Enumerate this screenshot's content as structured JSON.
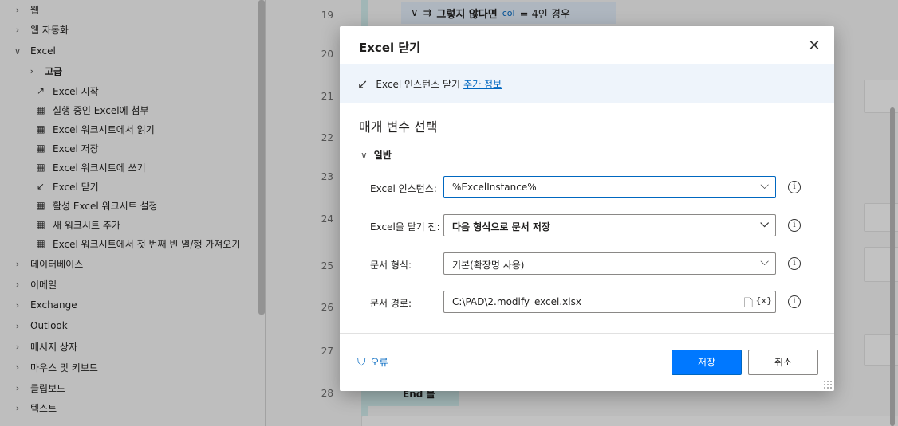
{
  "actions_pane": {
    "items": [
      {
        "type": "group",
        "label": "웹",
        "expanded": false
      },
      {
        "type": "group",
        "label": "웹 자동화",
        "expanded": false
      },
      {
        "type": "group",
        "label": "Excel",
        "expanded": true
      },
      {
        "type": "subgroup",
        "label": "고급",
        "expanded": false
      },
      {
        "type": "action",
        "label": "Excel 시작",
        "icon": "arrow-up-right-icon"
      },
      {
        "type": "action",
        "label": "실행 중인 Excel에 첨부",
        "icon": "excel-grid-icon"
      },
      {
        "type": "action",
        "label": "Excel 워크시트에서 읽기",
        "icon": "excel-grid-icon"
      },
      {
        "type": "action",
        "label": "Excel 저장",
        "icon": "excel-grid-icon"
      },
      {
        "type": "action",
        "label": "Excel 워크시트에 쓰기",
        "icon": "excel-grid-icon"
      },
      {
        "type": "action",
        "label": "Excel 닫기",
        "icon": "arrow-down-left-icon"
      },
      {
        "type": "action",
        "label": "활성 Excel 워크시트 설정",
        "icon": "excel-grid-icon"
      },
      {
        "type": "action",
        "label": "새 워크시트 추가",
        "icon": "excel-grid-icon"
      },
      {
        "type": "action",
        "label": "Excel 워크시트에서 첫 번째 빈 열/행 가져오기",
        "icon": "excel-grid-icon"
      },
      {
        "type": "group",
        "label": "데이터베이스",
        "expanded": false
      },
      {
        "type": "group",
        "label": "이메일",
        "expanded": false
      },
      {
        "type": "group",
        "label": "Exchange",
        "expanded": false
      },
      {
        "type": "group",
        "label": "Outlook",
        "expanded": false
      },
      {
        "type": "group",
        "label": "메시지 상자",
        "expanded": false
      },
      {
        "type": "group",
        "label": "마우스 및 키보드",
        "expanded": false
      },
      {
        "type": "group",
        "label": "클립보드",
        "expanded": false
      },
      {
        "type": "group",
        "label": "텍스트",
        "expanded": false
      }
    ]
  },
  "editor": {
    "line_numbers": [
      "19",
      "20",
      "21",
      "22",
      "23",
      "24",
      "25",
      "26",
      "27",
      "28"
    ],
    "else_block": {
      "keyword": "그렇지 않다면",
      "variable": "col",
      "condition": "= 4인 경우"
    },
    "end_block": {
      "label": "End 블"
    }
  },
  "dialog": {
    "title": "Excel 닫기",
    "close_glyph": "✕",
    "info_text": "Excel 인스턴스 닫기",
    "info_link": "추가 정보",
    "section_title": "매개 변수 선택",
    "group_label": "일반",
    "fields": [
      {
        "label": "Excel 인스턴스:",
        "value": "%ExcelInstance%"
      },
      {
        "label": "Excel을 닫기 전:",
        "value": "다음 형식으로 문서 저장"
      },
      {
        "label": "문서 형식:",
        "value": "기본(확장명 사용)"
      },
      {
        "label": "문서 경로:",
        "value": "C:\\PAD\\2.modify_excel.xlsx",
        "var_icon": "{x}"
      }
    ],
    "error_label": "오류",
    "save_label": "저장",
    "cancel_label": "취소"
  },
  "colors": {
    "accent": "#0078ff",
    "link": "#0067c0",
    "info_bar": "#eef4fb"
  }
}
